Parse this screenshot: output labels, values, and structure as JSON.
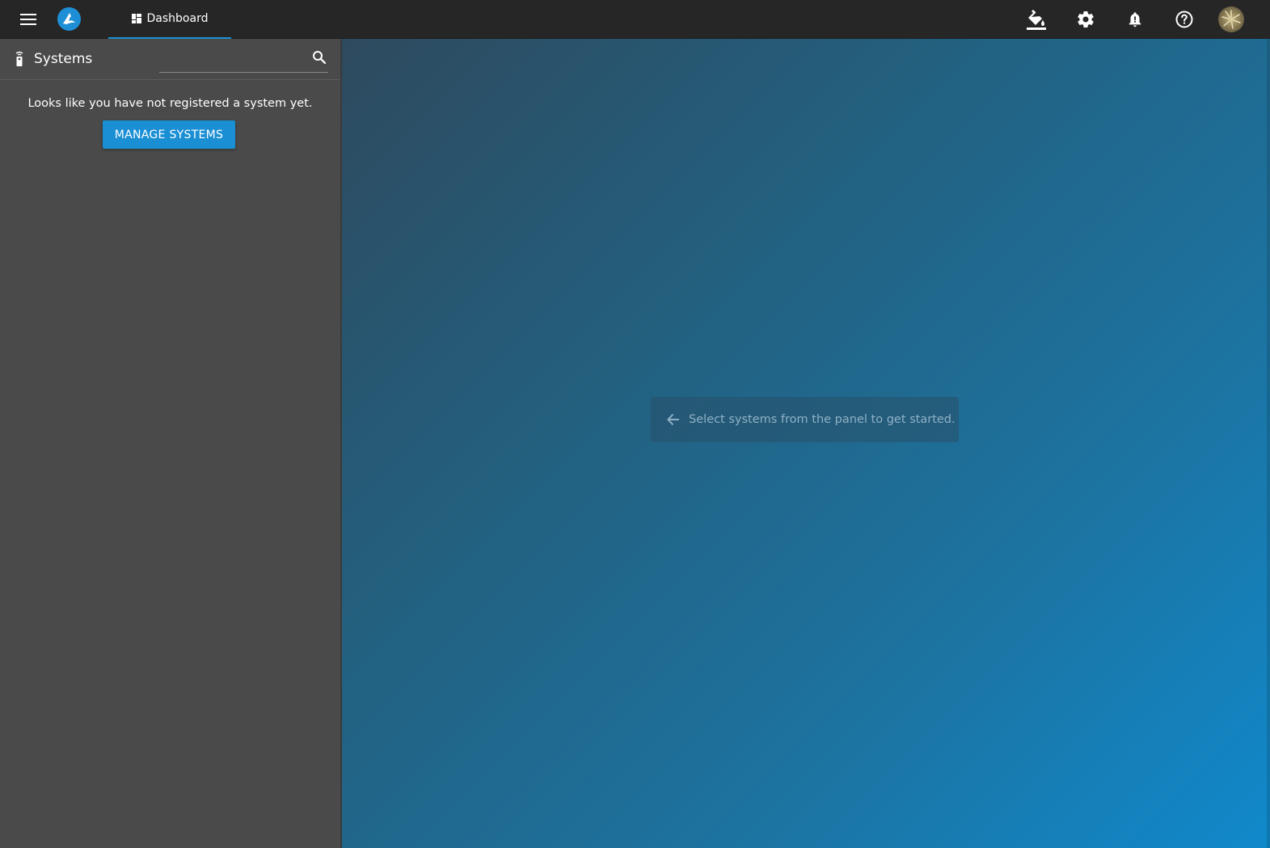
{
  "header": {
    "tabs": [
      {
        "label": "Dashboard",
        "icon": "dashboard-icon",
        "active": true
      }
    ],
    "actions": [
      {
        "icon": "paint-bucket-icon"
      },
      {
        "icon": "gear-icon"
      },
      {
        "icon": "bell-alert-icon"
      },
      {
        "icon": "help-circle-icon"
      }
    ],
    "accent_color": "#1a8fd4"
  },
  "sidebar": {
    "title": "Systems",
    "search": {
      "value": "",
      "placeholder": ""
    },
    "empty_message": "Looks like you have not registered a system yet.",
    "manage_button_label": "MANAGE SYSTEMS"
  },
  "main": {
    "hint_text": "Select systems from the panel to get started."
  }
}
